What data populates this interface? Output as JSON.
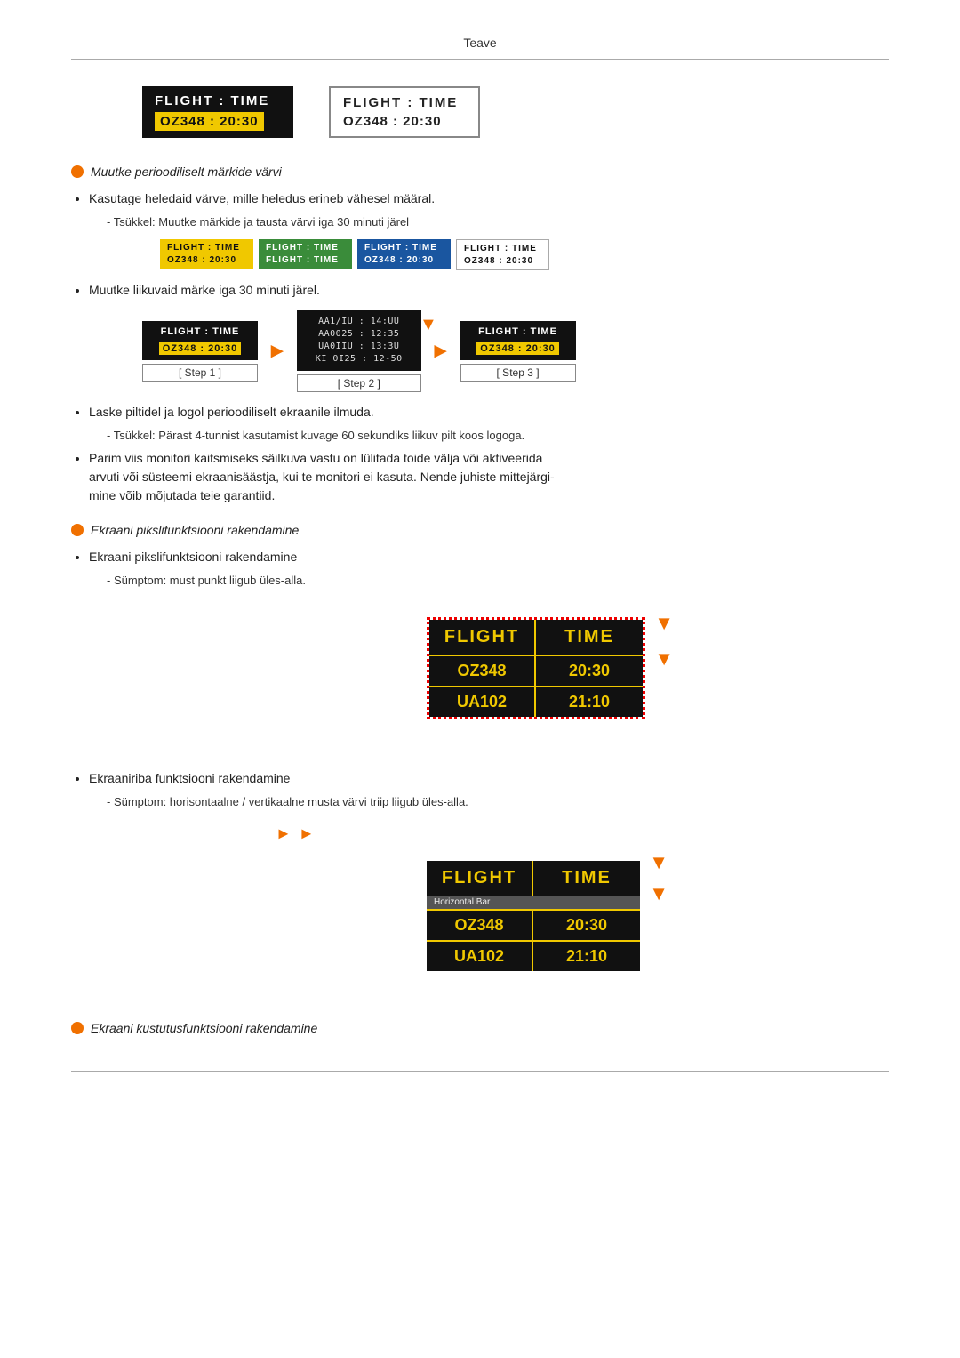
{
  "header": {
    "title": "Teave"
  },
  "topBoxes": [
    {
      "type": "dark",
      "label": "FLIGHT  :  TIME",
      "value": "OZ348   :  20:30"
    },
    {
      "type": "outline",
      "label": "FLIGHT  :  TIME",
      "value": "OZ348   :  20:30"
    }
  ],
  "section1": {
    "title": "Muutke perioodiliselt märkide värvi",
    "bullet1": "Kasutage heledaid värve, mille heledus erineb vähesel määral.",
    "sub1": "- Tsükkel: Muutke märkide ja tausta värvi iga 30 minuti järel",
    "colorBoxes": [
      {
        "bg": "yellow",
        "label": "FLIGHT  :  TIME",
        "value": "OZ348   : 20:30"
      },
      {
        "bg": "green",
        "label": "FLIGHT  :  TIME",
        "value": "FLIGHT  :  TIME"
      },
      {
        "bg": "blue",
        "label": "FLIGHT  :  TIME",
        "value": "OZ348   : 20:30"
      },
      {
        "bg": "white",
        "label": "FLIGHT  :  TIME",
        "value": "OZ348   : 20:30"
      }
    ],
    "bullet2": "Muutke liikuvaid märke iga 30 minuti järel.",
    "steps": [
      {
        "label": "[ Step 1 ]",
        "flightLabel": "FLIGHT  :  TIME",
        "flightValue": "OZ348   :  20:30"
      },
      {
        "label": "[ Step 2 ]",
        "scrambled1": "AA1/IU  :  14:UU",
        "scrambled2": "AA0025  :  12:35",
        "scrambled3": "UA0IIU  :  13:3U",
        "scrambled4": "KI 0I25  :  12-50"
      },
      {
        "label": "[ Step 3 ]",
        "flightLabel": "FLIGHT  :  TIME",
        "flightValue": "OZ348   :  20:30"
      }
    ],
    "bullet3": "Laske piltidel ja logol perioodiliselt ekraanile ilmuda.",
    "sub3": "- Tsükkel: Pärast 4-tunnist kasutamist kuvage 60 sekundiks liikuv pilt koos logoga.",
    "bullet4_1": "Parim viis monitori kaitsmiseks säilkuva vastu on lülitada toide välja või aktiveerida",
    "bullet4_2": "arvuti või süsteemi ekraanisäästja, kui te monitori ei kasuta. Nende juhiste mittejärgi-",
    "bullet4_3": "mine võib mõjutada teie garantiid."
  },
  "section2": {
    "title": "Ekraani pikslifunktsiooni rakendamine",
    "bullet1": "Ekraani pikslifunktsiooni rakendamine",
    "sub1": "- Sümptom: must punkt liigub üles-alla.",
    "pixelDisplay": {
      "col1": "FLIGHT",
      "col2": "TIME",
      "row1col1": "OZ348",
      "row1col2": "20:30",
      "row2col1": "UA102",
      "row2col2": "21:10"
    }
  },
  "section3": {
    "bullet1": "Ekraaniriba funktsiooni rakendamine",
    "sub1": "- Sümptom: horisontaalne / vertikaalne musta värvi triip liigub üles-alla.",
    "hbarDisplay": {
      "col1": "FLIGHT",
      "col2": "TIME",
      "subrow": "Horizontal Bar",
      "row1col1": "OZ348",
      "row1col2": "20:30",
      "row2col1": "UA102",
      "row2col2": "21:10"
    }
  },
  "section4": {
    "title": "Ekraani kustutusfunktsiooni rakendamine"
  }
}
